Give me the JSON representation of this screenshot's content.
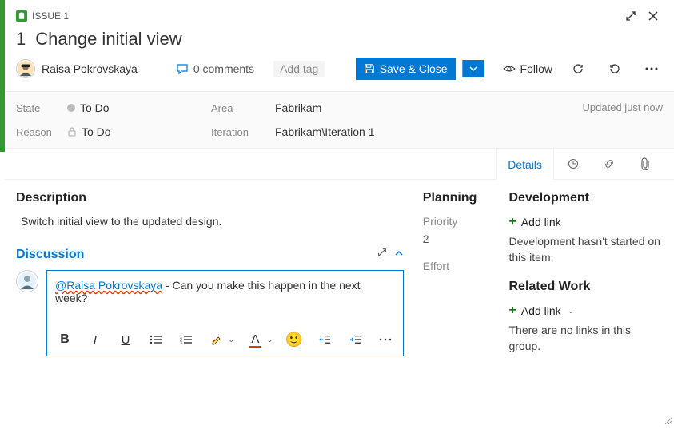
{
  "header": {
    "issue_label": "ISSUE 1",
    "id": "1",
    "title": "Change initial view",
    "assignee": "Raisa Pokrovskaya",
    "comments_count": "0 comments",
    "add_tag": "Add tag",
    "save_label": "Save & Close",
    "follow_label": "Follow",
    "updated": "Updated just now"
  },
  "fields": {
    "state_label": "State",
    "state_value": "To Do",
    "reason_label": "Reason",
    "reason_value": "To Do",
    "area_label": "Area",
    "area_value": "Fabrikam",
    "iteration_label": "Iteration",
    "iteration_value": "Fabrikam\\Iteration 1"
  },
  "tabs": {
    "details": "Details"
  },
  "description": {
    "heading": "Description",
    "text": "Switch initial view to the updated design."
  },
  "discussion": {
    "heading": "Discussion",
    "mention": "@Raisa Pokrovskaya",
    "rest": " - Can you make this happen in the next week?",
    "toolbar": {
      "bold": "B",
      "italic": "I",
      "under": "U",
      "font": "A"
    }
  },
  "planning": {
    "heading": "Planning",
    "priority_label": "Priority",
    "priority_value": "2",
    "effort_label": "Effort"
  },
  "development": {
    "heading": "Development",
    "add_link": "Add link",
    "helper": "Development hasn't started on this item."
  },
  "related": {
    "heading": "Related Work",
    "add_link": "Add link",
    "helper": "There are no links in this group."
  }
}
